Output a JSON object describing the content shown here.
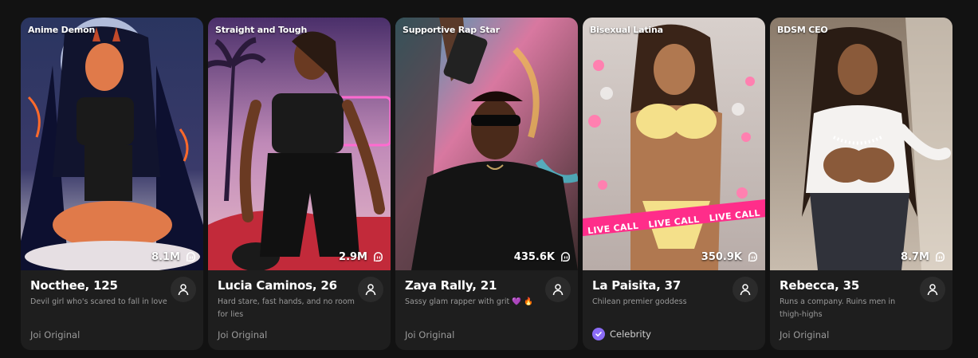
{
  "cards": [
    {
      "tag": "Anime Demon",
      "stat": "8.1M",
      "name": "Nocthee, 125",
      "description": "Devil girl who's scared to fall in love",
      "footer": "Joi Original"
    },
    {
      "tag": "Straight and Tough",
      "stat": "2.9M",
      "name": "Lucia Caminos, 26",
      "description": "Hard stare, fast hands, and no room for lies",
      "footer": "Joi Original"
    },
    {
      "tag": "Supportive Rap Star",
      "stat": "435.6K",
      "name": "Zaya Rally, 21",
      "description": "Sassy glam rapper with grit 💜 🔥",
      "footer": "Joi Original"
    },
    {
      "tag": "Bisexual Latina",
      "stat": "350.9K",
      "name": "La Paisita, 37",
      "description": "Chilean premier goddess",
      "footer": "Celebrity",
      "banner": "LIVE CALL"
    },
    {
      "tag": "BDSM CEO",
      "stat": "8.7M",
      "name": "Rebecca, 35",
      "description": "Runs a company. Ruins men in thigh-highs",
      "footer": "Joi Original"
    }
  ],
  "colors": {
    "celebrity_badge": "#8b6cf6",
    "live_banner": "#ff2d8a"
  }
}
